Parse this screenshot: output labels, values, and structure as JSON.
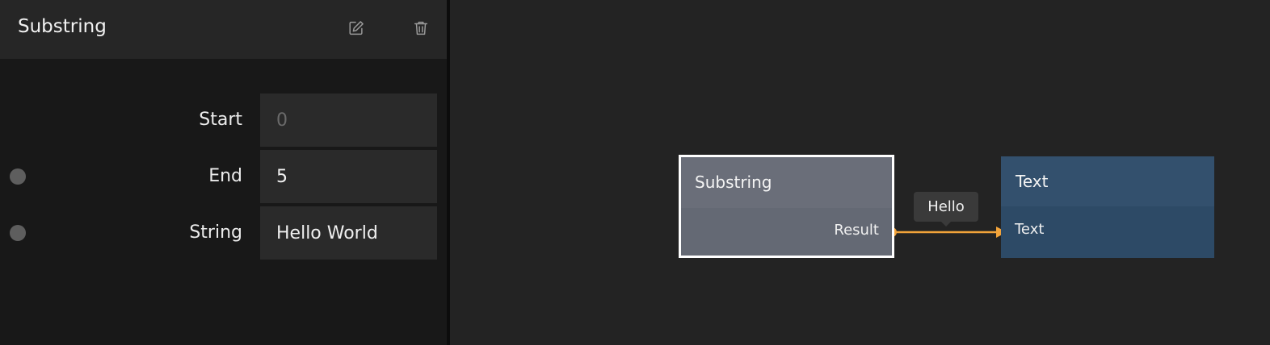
{
  "panel": {
    "title": "Substring",
    "icons": {
      "edit": "edit-icon",
      "delete": "trash-icon"
    },
    "properties": [
      {
        "label": "Start",
        "value": "",
        "placeholder": "0",
        "has_port": false
      },
      {
        "label": "End",
        "value": "5",
        "placeholder": "",
        "has_port": true
      },
      {
        "label": "String",
        "value": "Hello World",
        "placeholder": "",
        "has_port": true
      }
    ]
  },
  "canvas": {
    "nodes": [
      {
        "title": "Substring",
        "port": "Result"
      },
      {
        "title": "Text",
        "port": "Text"
      }
    ],
    "connection": {
      "value": "Hello",
      "color": "#f2a33a"
    }
  },
  "colors": {
    "panel_bg": "#181818",
    "canvas_bg": "#232323",
    "substring_node": "#646974",
    "text_node": "#2d4a66",
    "connection": "#f2a33a"
  }
}
